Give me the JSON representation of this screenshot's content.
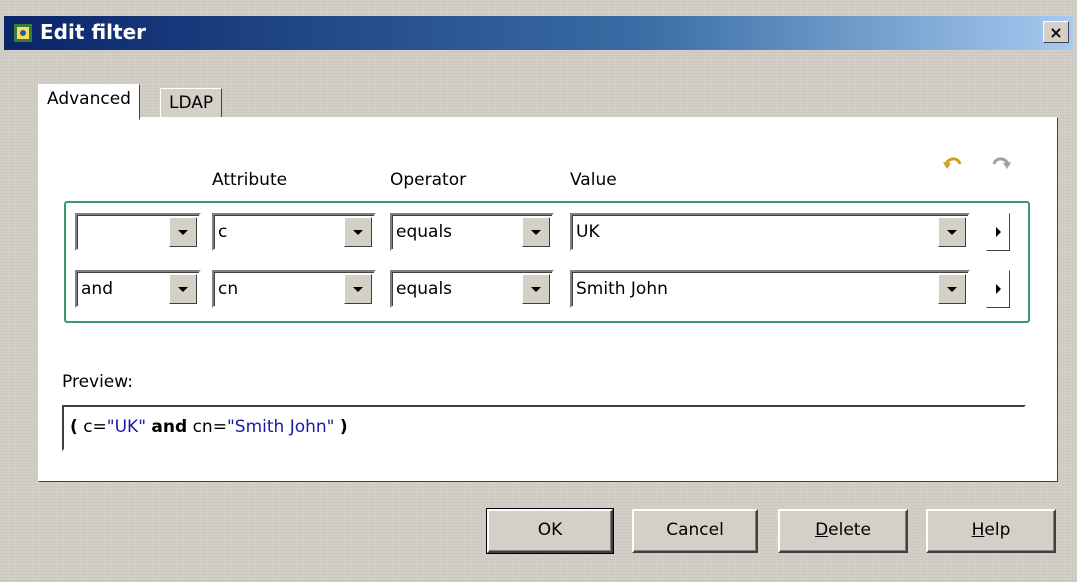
{
  "window": {
    "title": "Edit filter",
    "close_glyph": "×"
  },
  "tabs": [
    {
      "label": "Advanced",
      "active": true
    },
    {
      "label": "LDAP",
      "active": false
    }
  ],
  "columns": {
    "attribute": "Attribute",
    "operator": "Operator",
    "value": "Value"
  },
  "icons": {
    "undo": "undo-arrow-icon",
    "redo": "redo-arrow-icon",
    "app": "directory-icon"
  },
  "rows": [
    {
      "logic": "",
      "attribute": "c",
      "operator": "equals",
      "value": "UK"
    },
    {
      "logic": "and",
      "attribute": "cn",
      "operator": "equals",
      "value": "Smith John"
    }
  ],
  "preview": {
    "label": "Preview:",
    "open": "(",
    "attr1": "c=",
    "val1": "\"UK\"",
    "join": "and",
    "attr2": "cn=",
    "val2": "\"Smith John\"",
    "close": ")"
  },
  "buttons": {
    "ok": "OK",
    "cancel": "Cancel",
    "delete_d": "D",
    "delete_rest": "elete",
    "help_h": "H",
    "help_rest": "elp"
  },
  "colors": {
    "title_start": "#0a246a",
    "group_border": "#3a9a6a",
    "string_value": "#1a1aa6"
  }
}
